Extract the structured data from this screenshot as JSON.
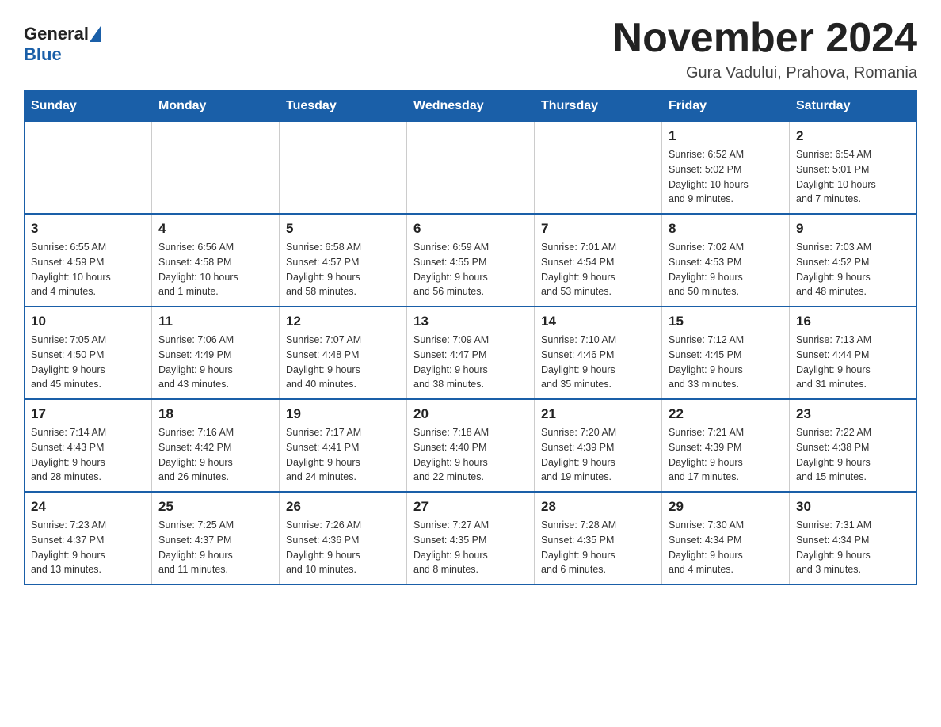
{
  "logo": {
    "general": "General",
    "blue": "Blue"
  },
  "title": "November 2024",
  "location": "Gura Vadului, Prahova, Romania",
  "days_of_week": [
    "Sunday",
    "Monday",
    "Tuesday",
    "Wednesday",
    "Thursday",
    "Friday",
    "Saturday"
  ],
  "weeks": [
    {
      "days": [
        {
          "number": "",
          "info": ""
        },
        {
          "number": "",
          "info": ""
        },
        {
          "number": "",
          "info": ""
        },
        {
          "number": "",
          "info": ""
        },
        {
          "number": "",
          "info": ""
        },
        {
          "number": "1",
          "info": "Sunrise: 6:52 AM\nSunset: 5:02 PM\nDaylight: 10 hours\nand 9 minutes."
        },
        {
          "number": "2",
          "info": "Sunrise: 6:54 AM\nSunset: 5:01 PM\nDaylight: 10 hours\nand 7 minutes."
        }
      ]
    },
    {
      "days": [
        {
          "number": "3",
          "info": "Sunrise: 6:55 AM\nSunset: 4:59 PM\nDaylight: 10 hours\nand 4 minutes."
        },
        {
          "number": "4",
          "info": "Sunrise: 6:56 AM\nSunset: 4:58 PM\nDaylight: 10 hours\nand 1 minute."
        },
        {
          "number": "5",
          "info": "Sunrise: 6:58 AM\nSunset: 4:57 PM\nDaylight: 9 hours\nand 58 minutes."
        },
        {
          "number": "6",
          "info": "Sunrise: 6:59 AM\nSunset: 4:55 PM\nDaylight: 9 hours\nand 56 minutes."
        },
        {
          "number": "7",
          "info": "Sunrise: 7:01 AM\nSunset: 4:54 PM\nDaylight: 9 hours\nand 53 minutes."
        },
        {
          "number": "8",
          "info": "Sunrise: 7:02 AM\nSunset: 4:53 PM\nDaylight: 9 hours\nand 50 minutes."
        },
        {
          "number": "9",
          "info": "Sunrise: 7:03 AM\nSunset: 4:52 PM\nDaylight: 9 hours\nand 48 minutes."
        }
      ]
    },
    {
      "days": [
        {
          "number": "10",
          "info": "Sunrise: 7:05 AM\nSunset: 4:50 PM\nDaylight: 9 hours\nand 45 minutes."
        },
        {
          "number": "11",
          "info": "Sunrise: 7:06 AM\nSunset: 4:49 PM\nDaylight: 9 hours\nand 43 minutes."
        },
        {
          "number": "12",
          "info": "Sunrise: 7:07 AM\nSunset: 4:48 PM\nDaylight: 9 hours\nand 40 minutes."
        },
        {
          "number": "13",
          "info": "Sunrise: 7:09 AM\nSunset: 4:47 PM\nDaylight: 9 hours\nand 38 minutes."
        },
        {
          "number": "14",
          "info": "Sunrise: 7:10 AM\nSunset: 4:46 PM\nDaylight: 9 hours\nand 35 minutes."
        },
        {
          "number": "15",
          "info": "Sunrise: 7:12 AM\nSunset: 4:45 PM\nDaylight: 9 hours\nand 33 minutes."
        },
        {
          "number": "16",
          "info": "Sunrise: 7:13 AM\nSunset: 4:44 PM\nDaylight: 9 hours\nand 31 minutes."
        }
      ]
    },
    {
      "days": [
        {
          "number": "17",
          "info": "Sunrise: 7:14 AM\nSunset: 4:43 PM\nDaylight: 9 hours\nand 28 minutes."
        },
        {
          "number": "18",
          "info": "Sunrise: 7:16 AM\nSunset: 4:42 PM\nDaylight: 9 hours\nand 26 minutes."
        },
        {
          "number": "19",
          "info": "Sunrise: 7:17 AM\nSunset: 4:41 PM\nDaylight: 9 hours\nand 24 minutes."
        },
        {
          "number": "20",
          "info": "Sunrise: 7:18 AM\nSunset: 4:40 PM\nDaylight: 9 hours\nand 22 minutes."
        },
        {
          "number": "21",
          "info": "Sunrise: 7:20 AM\nSunset: 4:39 PM\nDaylight: 9 hours\nand 19 minutes."
        },
        {
          "number": "22",
          "info": "Sunrise: 7:21 AM\nSunset: 4:39 PM\nDaylight: 9 hours\nand 17 minutes."
        },
        {
          "number": "23",
          "info": "Sunrise: 7:22 AM\nSunset: 4:38 PM\nDaylight: 9 hours\nand 15 minutes."
        }
      ]
    },
    {
      "days": [
        {
          "number": "24",
          "info": "Sunrise: 7:23 AM\nSunset: 4:37 PM\nDaylight: 9 hours\nand 13 minutes."
        },
        {
          "number": "25",
          "info": "Sunrise: 7:25 AM\nSunset: 4:37 PM\nDaylight: 9 hours\nand 11 minutes."
        },
        {
          "number": "26",
          "info": "Sunrise: 7:26 AM\nSunset: 4:36 PM\nDaylight: 9 hours\nand 10 minutes."
        },
        {
          "number": "27",
          "info": "Sunrise: 7:27 AM\nSunset: 4:35 PM\nDaylight: 9 hours\nand 8 minutes."
        },
        {
          "number": "28",
          "info": "Sunrise: 7:28 AM\nSunset: 4:35 PM\nDaylight: 9 hours\nand 6 minutes."
        },
        {
          "number": "29",
          "info": "Sunrise: 7:30 AM\nSunset: 4:34 PM\nDaylight: 9 hours\nand 4 minutes."
        },
        {
          "number": "30",
          "info": "Sunrise: 7:31 AM\nSunset: 4:34 PM\nDaylight: 9 hours\nand 3 minutes."
        }
      ]
    }
  ]
}
